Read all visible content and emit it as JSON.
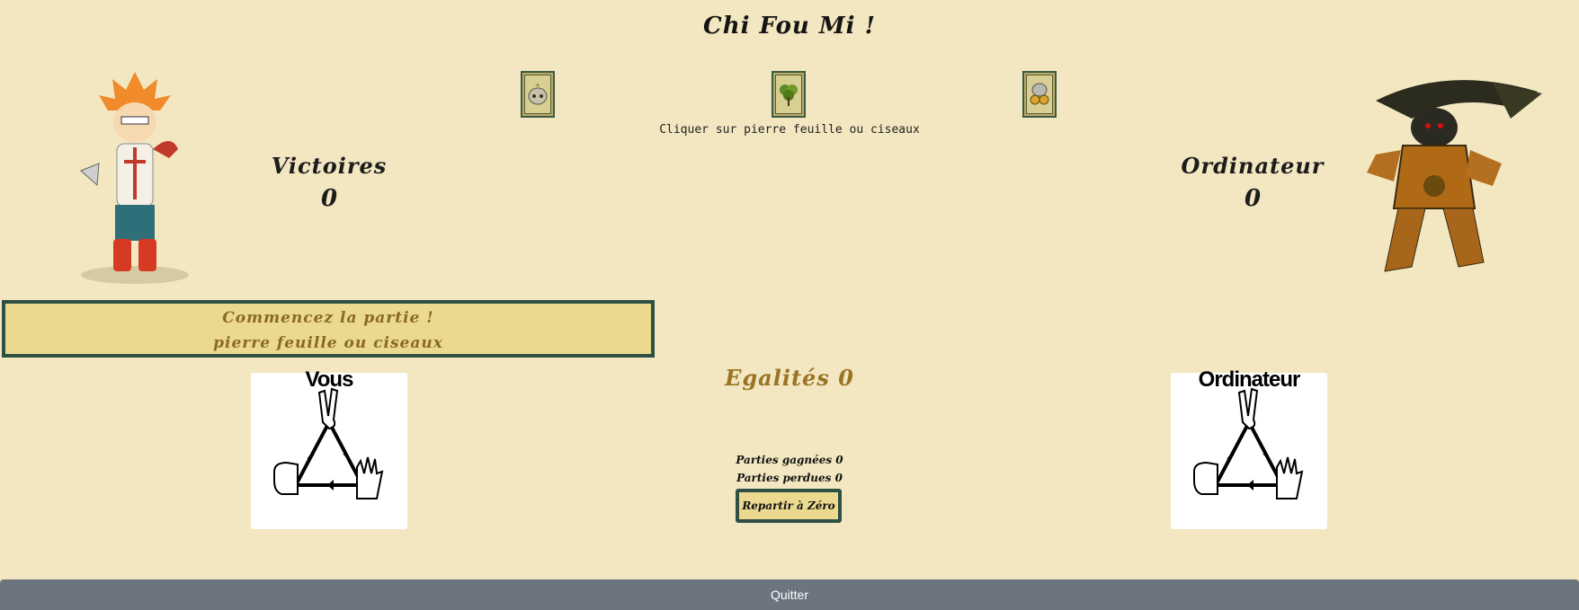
{
  "title": "Chi Fou Mi !",
  "choices": [
    {
      "name": "pierre",
      "icon": "rock-card-icon"
    },
    {
      "name": "feuille",
      "icon": "leaf-card-icon"
    },
    {
      "name": "ciseaux",
      "icon": "scissors-card-icon"
    }
  ],
  "hint": "Cliquer sur pierre feuille ou ciseaux",
  "player": {
    "label": "Victoires",
    "score": "0",
    "panel_title": "Vous"
  },
  "computer": {
    "label": "Ordinateur",
    "score": "0",
    "panel_title": "Ordinateur"
  },
  "message": {
    "line1": "Commencez la partie !",
    "line2": "pierre feuille ou ciseaux"
  },
  "ties": "Egalités 0",
  "stats": {
    "won": "Parties gagnées 0",
    "lost": "Parties perdues 0"
  },
  "reset_label": "Repartir à Zéro",
  "footer_label": "Quitter",
  "colors": {
    "background": "#f2e7c0",
    "box": "#ead98f",
    "border": "#2f4f45",
    "accent": "#9a7424",
    "footer": "#6c7480"
  }
}
